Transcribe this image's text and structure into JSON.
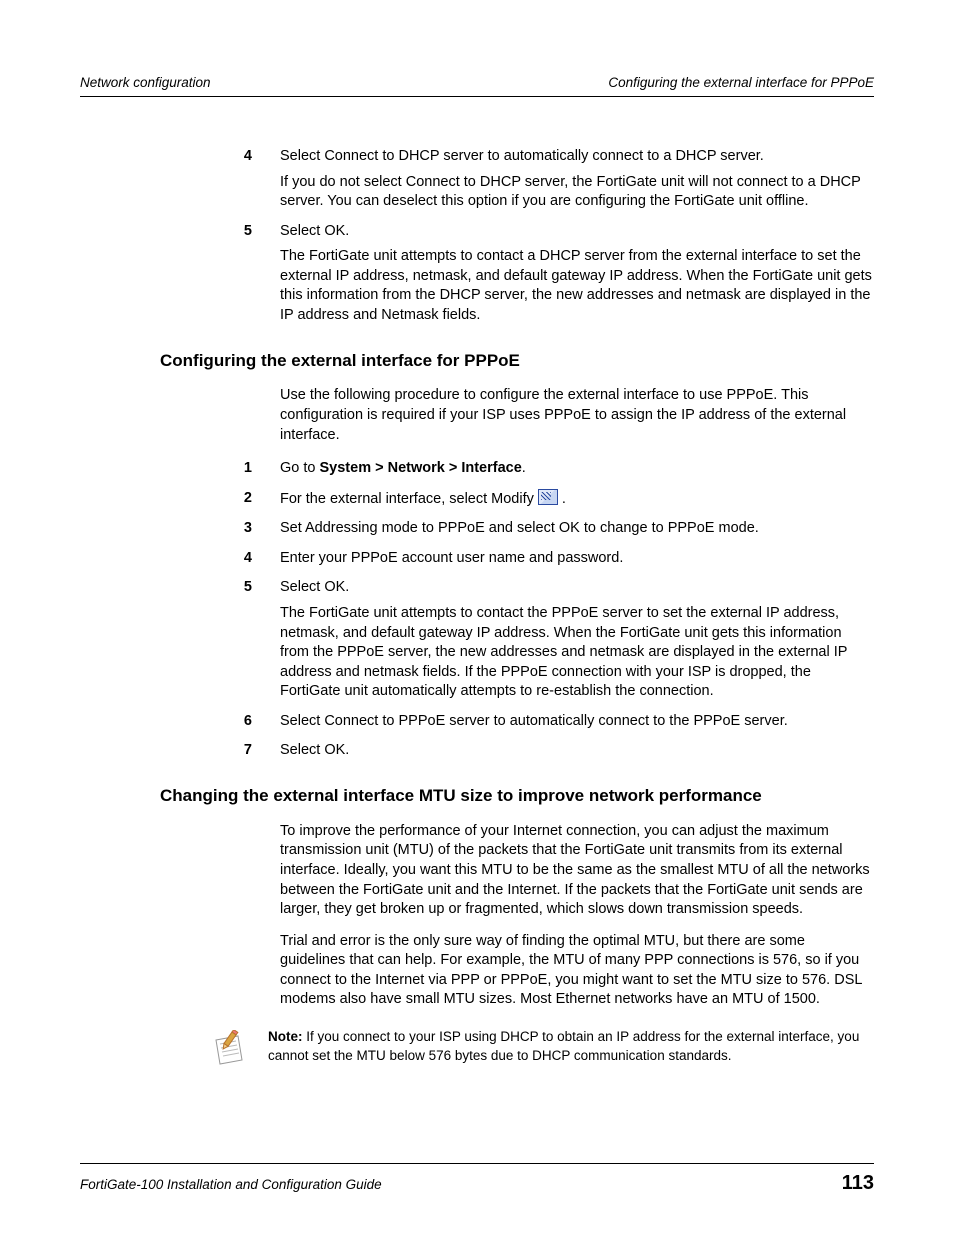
{
  "header": {
    "left": "Network configuration",
    "right": "Configuring the external interface for PPPoE"
  },
  "top_steps": [
    {
      "num": "4",
      "paras": [
        "Select Connect to DHCP server to automatically connect to a DHCP server.",
        "If you do not select Connect to DHCP server, the FortiGate unit will not connect to a DHCP server. You can deselect this option if you are configuring the FortiGate unit offline."
      ]
    },
    {
      "num": "5",
      "paras": [
        "Select OK.",
        "The FortiGate unit attempts to contact a DHCP server from the external interface to set the external IP address, netmask, and default gateway IP address. When the FortiGate unit gets this information from the DHCP server, the new addresses and netmask are displayed in the IP address and Netmask fields."
      ]
    }
  ],
  "section1": {
    "title": "Configuring the external interface for PPPoE",
    "intro": "Use the following procedure to configure the external interface to use PPPoE. This configuration is required if your ISP uses PPPoE to assign the IP address of the external interface.",
    "steps": [
      {
        "num": "1",
        "html": "Go to <strong>System > Network > Interface</strong>."
      },
      {
        "num": "2",
        "html": "For the external interface, select Modify <span class=\"modify-icon\" data-name=\"modify-icon\" data-interactable=\"false\"></span> ."
      },
      {
        "num": "3",
        "html": "Set Addressing mode to PPPoE and select OK to change to PPPoE mode."
      },
      {
        "num": "4",
        "html": "Enter your PPPoE account user name and password."
      },
      {
        "num": "5",
        "html": "Select OK.<p style=\"margin:6px 0 0 0\">The FortiGate unit attempts to contact the PPPoE server to set the external IP address, netmask, and default gateway IP address. When the FortiGate unit gets this information from the PPPoE server, the new addresses and netmask are displayed in the external IP address and netmask fields. If the PPPoE connection with your ISP is dropped, the FortiGate unit automatically attempts to re-establish the connection.</p>"
      },
      {
        "num": "6",
        "html": "Select Connect to PPPoE server to automatically connect to the PPPoE server."
      },
      {
        "num": "7",
        "html": "Select OK."
      }
    ]
  },
  "section2": {
    "title": "Changing the external interface MTU size to improve network performance",
    "paras": [
      "To improve the performance of your Internet connection, you can adjust the maximum transmission unit (MTU) of the packets that the FortiGate unit transmits from its external interface. Ideally, you want this MTU to be the same as the smallest MTU of all the networks between the FortiGate unit and the Internet. If the packets that the FortiGate unit sends are larger, they get broken up or fragmented, which slows down transmission speeds.",
      "Trial and error is the only sure way of finding the optimal MTU, but there are some guidelines that can help. For example, the MTU of many PPP connections is 576, so if you connect to the Internet via PPP or PPPoE, you might want to set the MTU size to 576. DSL modems also have small MTU sizes. Most Ethernet networks have an MTU of 1500."
    ],
    "note_label": "Note:",
    "note_text": " If you connect to your ISP using DHCP to obtain an IP address for the external interface, you cannot set the MTU below 576 bytes due to DHCP communication standards."
  },
  "footer": {
    "title": "FortiGate-100 Installation and Configuration Guide",
    "page": "113"
  }
}
